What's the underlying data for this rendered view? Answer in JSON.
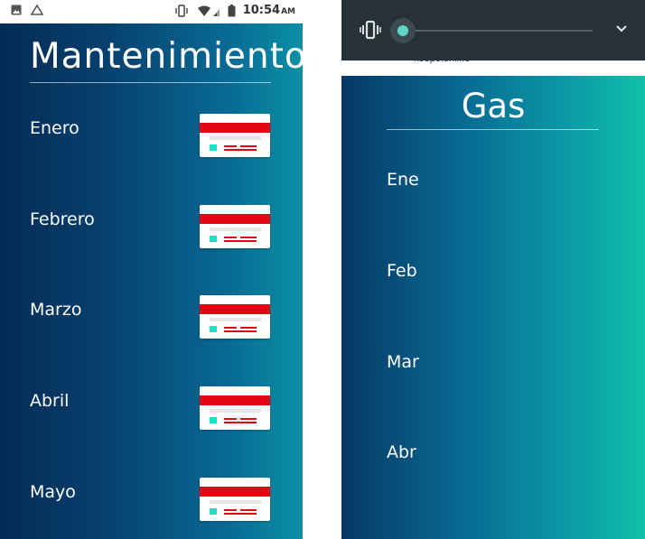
{
  "left_screen": {
    "status_bar": {
      "time": "10:54",
      "ampm": "AM"
    },
    "title": "Mantenimiento",
    "months": [
      "Enero",
      "Febrero",
      "Marzo",
      "Abril",
      "Mayo"
    ]
  },
  "right_screen": {
    "behind_text": "keepo.online",
    "title": "Gas",
    "months": [
      "Ene",
      "Feb",
      "Mar",
      "Abr"
    ],
    "volume_level": 0.05
  },
  "colors": {
    "card_red": "#e30613",
    "teal_accent": "#1ee0c8",
    "slider_knob": "#5fd6c7"
  }
}
